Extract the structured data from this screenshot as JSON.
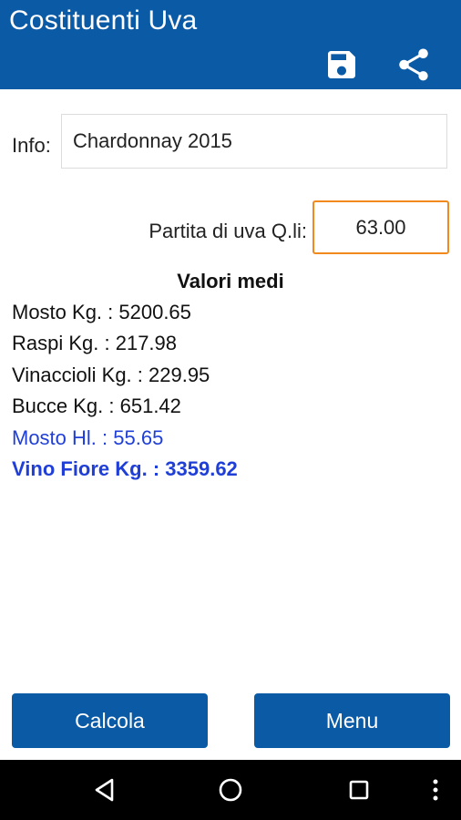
{
  "app_bar": {
    "title": "Costituenti Uva",
    "actions": [
      {
        "icon": "save-icon"
      },
      {
        "icon": "share-icon"
      }
    ],
    "color": "#0b5aa6"
  },
  "form": {
    "info_label": "Info:",
    "info_value": "Chardonnay 2015",
    "partita_label": "Partita di uva Q.li:",
    "partita_value": "63.00"
  },
  "results": {
    "title": "Valori medi",
    "lines": [
      "Mosto Kg. : 5200.65",
      "Raspi Kg. : 217.98",
      "Vinaccioli Kg. : 229.95",
      "Bucce Kg. : 651.42",
      "Mosto Hl. : 55.65",
      "Vino Fiore Kg. : 3359.62"
    ],
    "highlight_color": "#1f3fd6"
  },
  "buttons": {
    "calcola": "Calcola",
    "menu": "Menu"
  },
  "system_nav": {
    "icons": [
      "back-icon",
      "home-icon",
      "recents-icon",
      "overflow-icon"
    ]
  }
}
